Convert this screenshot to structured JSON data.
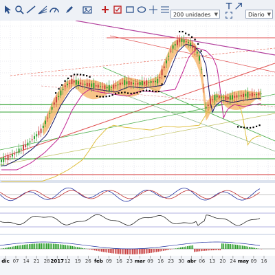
{
  "toolbar": {
    "units_select": "200 unidades",
    "period_select": "Diario",
    "icons": [
      "cursor-icon",
      "search-icon",
      "line-tool-icon",
      "fan-icon",
      "gauge-icon",
      "pen-icon",
      "image-icon",
      "plus-icon",
      "checkbox-icon",
      "rectangle-icon",
      "ellipse-icon",
      "crosshair-icon",
      "fibonacci-icon",
      "text-icon",
      "expand-icon",
      "arrow-icon"
    ]
  },
  "chart": {
    "x_axis_labels": [
      {
        "text": "dic",
        "bold": true
      },
      {
        "text": "07",
        "bold": false
      },
      {
        "text": "14",
        "bold": false
      },
      {
        "text": "21",
        "bold": false
      },
      {
        "text": "28",
        "bold": false
      },
      {
        "text": "2017",
        "bold": true
      },
      {
        "text": "12",
        "bold": false
      },
      {
        "text": "19",
        "bold": false
      },
      {
        "text": "26",
        "bold": false
      },
      {
        "text": "feb",
        "bold": true
      },
      {
        "text": "09",
        "bold": false
      },
      {
        "text": "16",
        "bold": false
      },
      {
        "text": "23",
        "bold": false
      },
      {
        "text": "mar",
        "bold": true
      },
      {
        "text": "09",
        "bold": false
      },
      {
        "text": "16",
        "bold": false
      },
      {
        "text": "23",
        "bold": false
      },
      {
        "text": "30",
        "bold": false
      },
      {
        "text": "abr",
        "bold": true
      },
      {
        "text": "06",
        "bold": false
      },
      {
        "text": "13",
        "bold": false
      },
      {
        "text": "20",
        "bold": false
      },
      {
        "text": "24",
        "bold": false
      },
      {
        "text": "may",
        "bold": true
      },
      {
        "text": "09",
        "bold": false
      },
      {
        "text": "16",
        "bold": false
      }
    ],
    "colors": {
      "bull_candle": "#2e9e2e",
      "bear_candle": "#c84040",
      "cloud": "#f5b060",
      "ma_fast": "#101060",
      "ma_mid": "#c02090",
      "ma_slow": "#e0c040",
      "support": "#30a030",
      "resistance": "#d03030"
    }
  }
}
